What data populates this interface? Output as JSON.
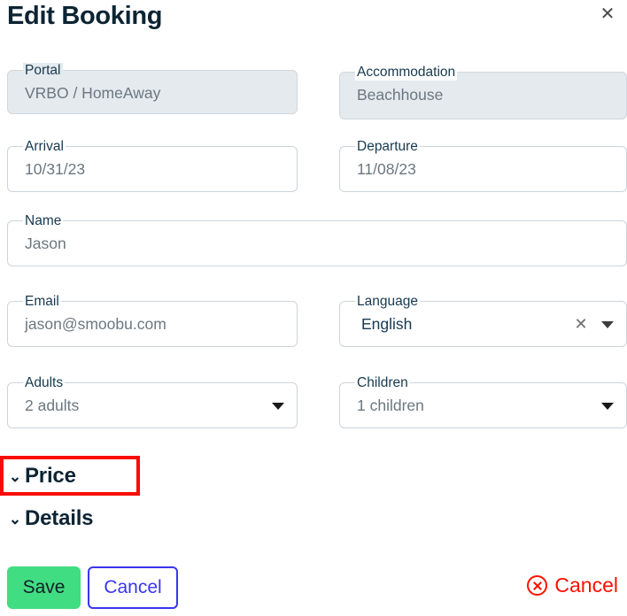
{
  "header": {
    "title": "Edit Booking",
    "close_icon": "close-icon",
    "close_glyph": "✕"
  },
  "fields": {
    "portal": {
      "label": "Portal",
      "value": "VRBO / HomeAway",
      "disabled": true
    },
    "accommodation": {
      "label": "Accommodation",
      "value": "Beachhouse",
      "disabled": true
    },
    "arrival": {
      "label": "Arrival",
      "value": "10/31/23",
      "disabled": false
    },
    "departure": {
      "label": "Departure",
      "value": "11/08/23",
      "disabled": false
    },
    "name": {
      "label": "Name",
      "value": "Jason",
      "disabled": false
    },
    "email": {
      "label": "Email",
      "value": "jason@smoobu.com",
      "disabled": false
    },
    "language": {
      "label": "Language",
      "value": "English",
      "disabled": false,
      "clear_glyph": "✕",
      "clear_icon": "clear-icon",
      "caret_icon": "chevron-down-icon"
    },
    "adults": {
      "label": "Adults",
      "value": "2 adults",
      "disabled": false,
      "caret_icon": "chevron-down-icon"
    },
    "children": {
      "label": "Children",
      "value": "1 children",
      "disabled": false,
      "caret_icon": "chevron-down-icon"
    }
  },
  "accordions": [
    {
      "label": "Price",
      "chevron": "⌄",
      "expanded": false,
      "highlighted": true
    },
    {
      "label": "Details",
      "chevron": "⌄",
      "expanded": false,
      "highlighted": false
    }
  ],
  "footer": {
    "save_label": "Save",
    "cancel_label": "Cancel",
    "cancel_booking_label": "Cancel"
  },
  "colors": {
    "title": "#0c2433",
    "label": "#16394f",
    "value": "#6b7780",
    "field_border": "#ccd4dc",
    "disabled_fill": "#e4eaee",
    "save_green": "#41dd82",
    "cancel_blue": "#3b35f0",
    "danger_red": "#fb1100",
    "highlight_red": "#fb0a06"
  }
}
